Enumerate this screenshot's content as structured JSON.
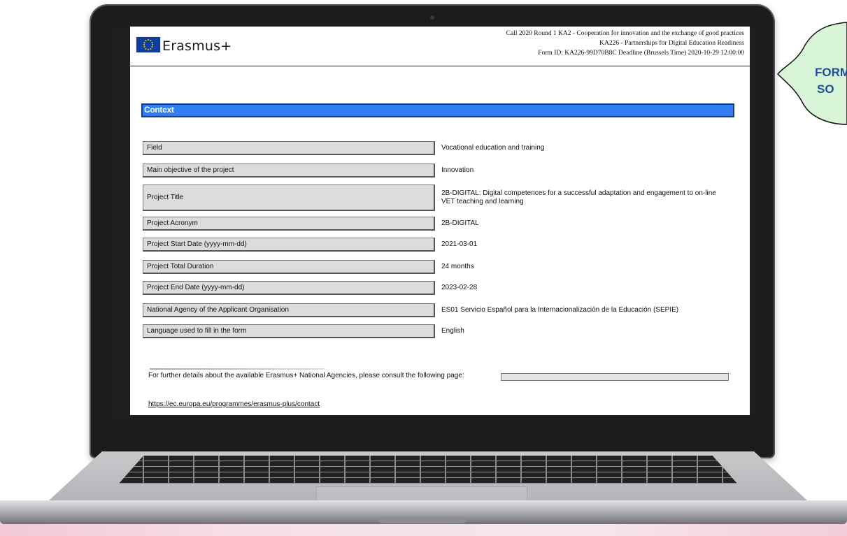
{
  "header": {
    "brand": "Erasmus+",
    "line1": "Call 2020 Round 1 KA2 - Cooperation for innovation and the exchange of good practices",
    "line2": "KA226 - Partnerships for Digital Education Readiness",
    "line3": "Form ID: KA226-99D70B8C Deadline (Brussels Time) 2020-10-29 12:00:00"
  },
  "section": {
    "title": "Context"
  },
  "rows": [
    {
      "label": "Field",
      "value": "Vocational education and training"
    },
    {
      "label": "Main objective of the project",
      "value": "Innovation"
    },
    {
      "label": "Project Title",
      "value": "2B-DIGITAL: Digital competences for a successful adaptation and engagement to on-line VET teaching and learning"
    },
    {
      "label": "Project Acronym",
      "value": "2B-DIGITAL"
    },
    {
      "label": "Project Start Date (yyyy-mm-dd)",
      "value": "2021-03-01"
    },
    {
      "label": "Project Total Duration",
      "value": "24 months"
    },
    {
      "label": "Project End Date (yyyy-mm-dd)",
      "value": "2023-02-28"
    },
    {
      "label": "National Agency of the Applicant Organisation",
      "value": "ES01 Servicio Español para la Internacionalización de la Educación (SEPIE)"
    },
    {
      "label": "Language used to fill in the form",
      "value": "English"
    }
  ],
  "footer": {
    "note": "For further details about the available Erasmus+ National Agencies, please consult the following page:",
    "link": "https://ec.europa.eu/programmes/erasmus-plus/contact"
  },
  "callout": {
    "line1": "FORM",
    "line2": "SO"
  },
  "colors": {
    "section_bar": "#2f7df3",
    "callout_fill": "#d8f5d8",
    "callout_text": "#1f4e99"
  },
  "icons": {
    "flag": "eu-flag-icon"
  }
}
